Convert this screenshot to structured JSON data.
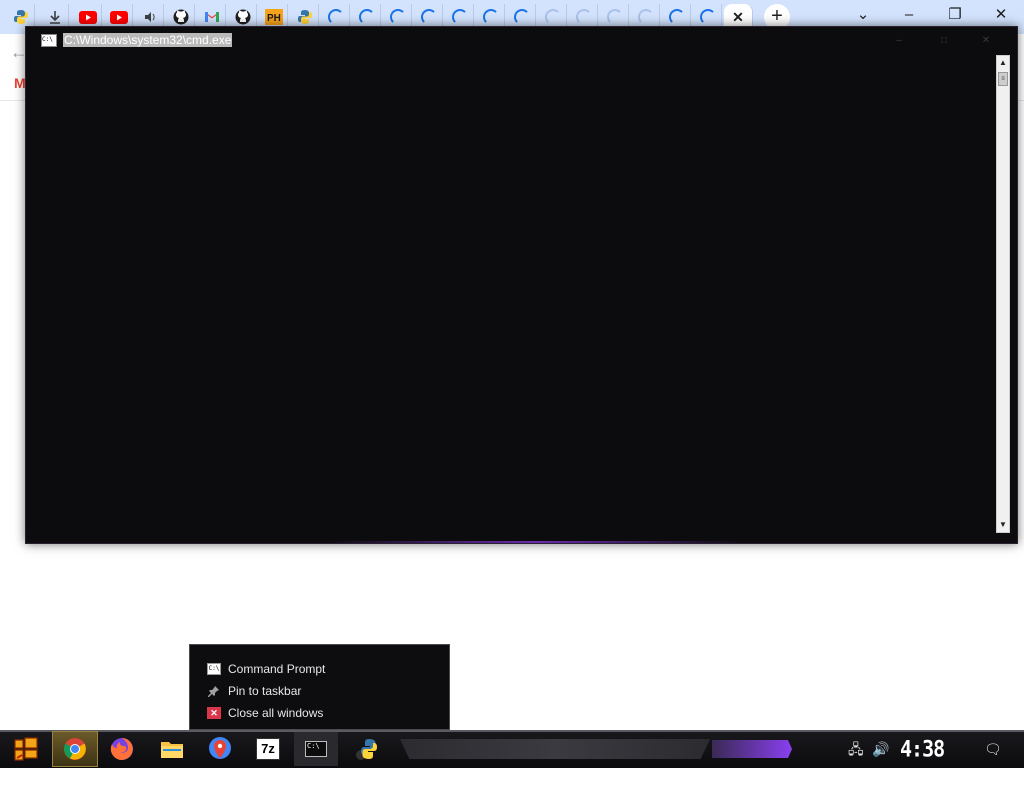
{
  "browser": {
    "new_tab_label": "+",
    "tab_list_label": "⌄",
    "minimize_label": "–",
    "restore_label": "❐",
    "close_label": "✕",
    "active_tab_close": "✕",
    "back_label": "←",
    "bookmark_gmail": "M"
  },
  "cmd_window": {
    "title": "C:\\Windows\\system32\\cmd.exe",
    "icon_text": "C:\\",
    "minimize_label": "–",
    "maximize_label": "□",
    "close_label": "✕",
    "scroll_up": "▲",
    "scroll_down": "▼",
    "scroll_thumb": "≡"
  },
  "jumplist": {
    "items": [
      {
        "label": "Command Prompt",
        "icon": "cmd-icon"
      },
      {
        "label": "Pin to taskbar",
        "icon": "pin-icon"
      },
      {
        "label": "Close all windows",
        "icon": "close-icon"
      }
    ],
    "cmd_icon_text": "C:\\",
    "pin_glyph": "📌",
    "close_glyph": "✕"
  },
  "taskbar": {
    "apps": [
      {
        "name": "start-icon"
      },
      {
        "name": "chrome-icon"
      },
      {
        "name": "firefox-icon"
      },
      {
        "name": "file-explorer-icon"
      },
      {
        "name": "maps-pin-icon"
      },
      {
        "label": "7z",
        "name": "7zip-icon"
      },
      {
        "name": "cmd-icon"
      },
      {
        "name": "python-icon"
      }
    ],
    "seven_zip_label": "7z",
    "cmd_label": "C:\\",
    "clock": "4:38 AM",
    "network_glyph": "🖧",
    "volume_glyph": "🔊",
    "notification_glyph": "🗨"
  }
}
